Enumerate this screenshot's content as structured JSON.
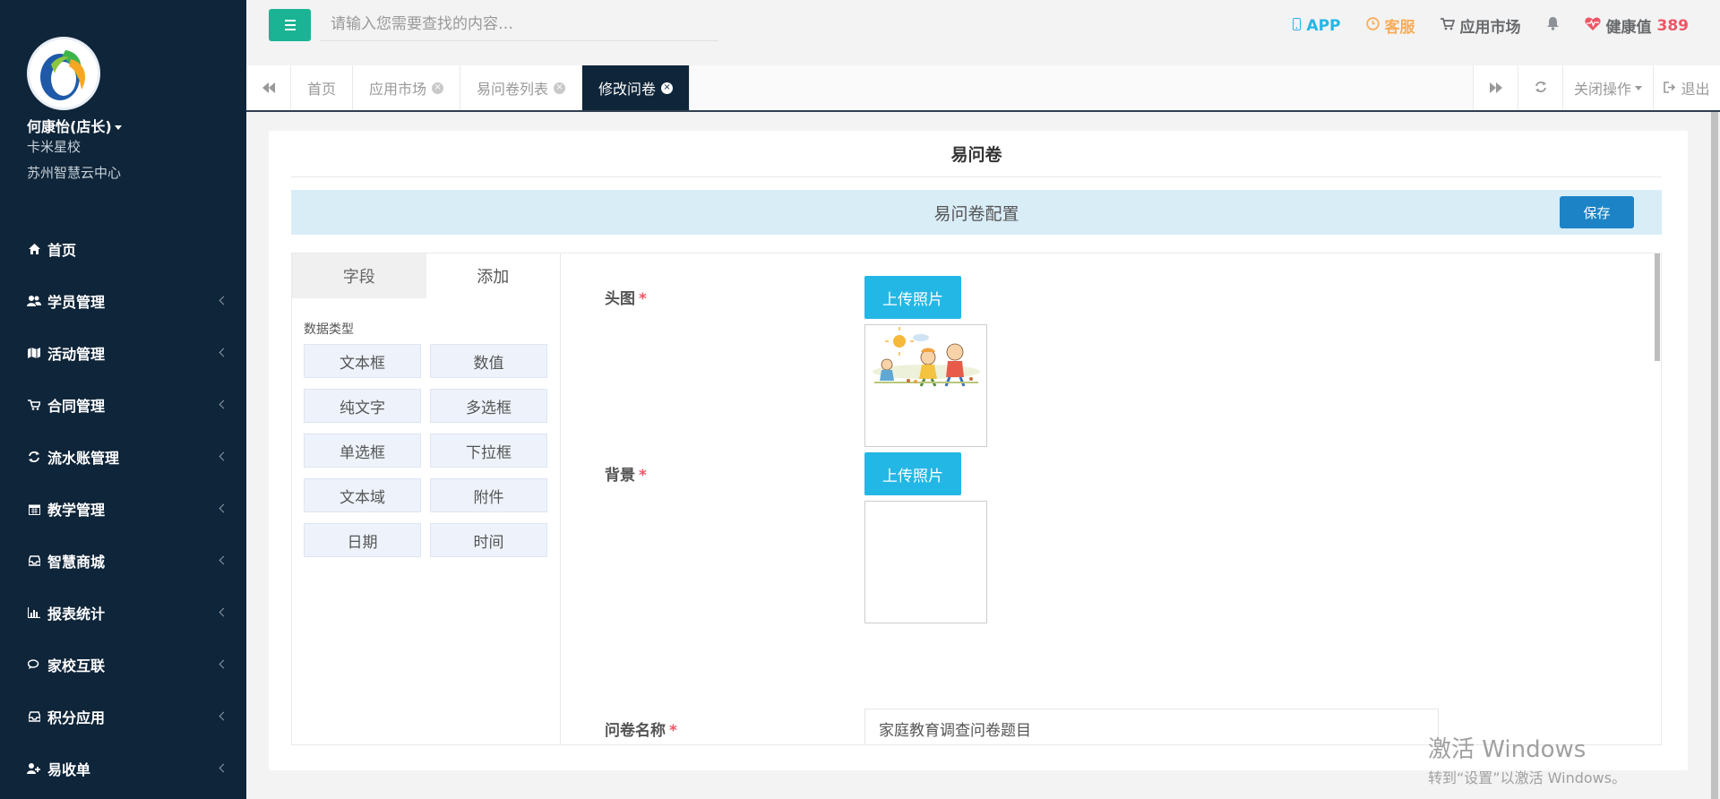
{
  "user": {
    "name": "何康怡(店长)",
    "school": "卡米星校",
    "center": "苏州智慧云中心"
  },
  "nav": [
    {
      "label": "首页",
      "icon": "home-icon",
      "has_arrow": false
    },
    {
      "label": "学员管理",
      "icon": "users-icon",
      "has_arrow": true
    },
    {
      "label": "活动管理",
      "icon": "map-icon",
      "has_arrow": true
    },
    {
      "label": "合同管理",
      "icon": "cart-icon",
      "has_arrow": true
    },
    {
      "label": "流水账管理",
      "icon": "exchange-icon",
      "has_arrow": true
    },
    {
      "label": "教学管理",
      "icon": "calendar-icon",
      "has_arrow": true
    },
    {
      "label": "智慧商城",
      "icon": "inbox-icon",
      "has_arrow": true
    },
    {
      "label": "报表统计",
      "icon": "bar-chart-icon",
      "has_arrow": true
    },
    {
      "label": "家校互联",
      "icon": "comments-icon",
      "has_arrow": true
    },
    {
      "label": "积分应用",
      "icon": "inbox-icon",
      "has_arrow": true
    },
    {
      "label": "易收单",
      "icon": "user-plus-icon",
      "has_arrow": true
    }
  ],
  "topbar": {
    "search_placeholder": "请输入您需要查找的内容…",
    "app_label": "APP",
    "service_label": "客服",
    "market_label": "应用市场",
    "health_label": "健康值",
    "health_value": "389"
  },
  "tabs": [
    {
      "label": "首页",
      "closable": false,
      "active": false
    },
    {
      "label": "应用市场",
      "closable": true,
      "active": false
    },
    {
      "label": "易问卷列表",
      "closable": true,
      "active": false
    },
    {
      "label": "修改问卷",
      "closable": true,
      "active": true
    }
  ],
  "tab_actions": {
    "close_ops_label": "关闭操作",
    "logout_label": "退出"
  },
  "panel": {
    "title": "易问卷",
    "config_title": "易问卷配置",
    "save_label": "保存"
  },
  "palette": {
    "tab_fields": "字段",
    "tab_add": "添加",
    "heading": "数据类型",
    "types": [
      "文本框",
      "数值",
      "纯文字",
      "多选框",
      "单选框",
      "下拉框",
      "文本域",
      "附件",
      "日期",
      "时间"
    ]
  },
  "form": {
    "head_label": "头图",
    "background_label": "背景",
    "upload_label": "上传照片",
    "name_label": "问卷名称",
    "name_value": "家庭教育调查问卷题目",
    "required_mark": "*"
  },
  "watermark": {
    "line1": "激活 Windows",
    "line2": "转到“设置”以激活 Windows。"
  },
  "colors": {
    "sidebar_bg": "#0f2539",
    "accent_green": "#1ab394",
    "upload_blue": "#23b7e5",
    "save_blue": "#1c84c6",
    "config_bg": "#d9edf7",
    "health_red": "#ed5565",
    "service_orange": "#f8ac59"
  }
}
